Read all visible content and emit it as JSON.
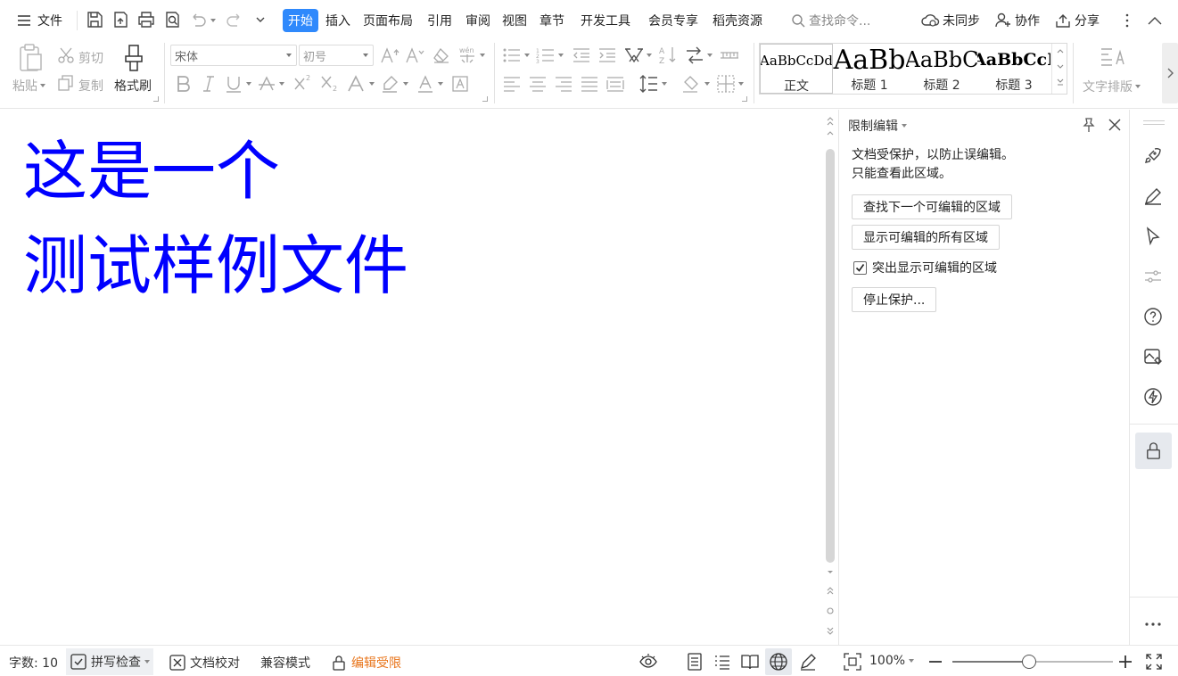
{
  "menubar": {
    "file_label": "文件",
    "tabs": [
      "开始",
      "插入",
      "页面布局",
      "引用",
      "审阅",
      "视图",
      "章节",
      "开发工具",
      "会员专享",
      "稻壳资源"
    ],
    "search_placeholder": "查找命令...",
    "sync_label": "未同步",
    "collab_label": "协作",
    "share_label": "分享"
  },
  "ribbon": {
    "paste_label": "粘贴",
    "cut_label": "剪切",
    "copy_label": "复制",
    "format_painter_label": "格式刷",
    "font_name": "宋体",
    "font_size": "初号",
    "styles": [
      {
        "preview": "AaBbCcDd",
        "name": "正文"
      },
      {
        "preview": "AaBb",
        "name": "标题 1"
      },
      {
        "preview": "AaBbC",
        "name": "标题 2"
      },
      {
        "preview": "AaBbCcI",
        "name": "标题 3"
      }
    ],
    "text_layout_label": "文字排版"
  },
  "document": {
    "lines": [
      "这是一个",
      "测试样例文件"
    ],
    "text_color": "#0000ff"
  },
  "taskpane": {
    "title": "限制编辑",
    "desc_line1": "文档受保护，以防止误编辑。",
    "desc_line2": "只能查看此区域。",
    "find_next_button": "查找下一个可编辑的区域",
    "show_all_button": "显示可编辑的所有区域",
    "highlight_checkbox_label": "突出显示可编辑的区域",
    "highlight_checked": true,
    "stop_protect_button": "停止保护..."
  },
  "statusbar": {
    "word_count": "字数: 10",
    "spell_check": "拼写检查",
    "proofread": "文档校对",
    "compat_mode": "兼容模式",
    "edit_restricted": "编辑受限",
    "edit_restricted_color": "#e8741a",
    "zoom": "100%",
    "zoom_level": 1.0
  },
  "colors": {
    "accent": "#2f89fc"
  }
}
